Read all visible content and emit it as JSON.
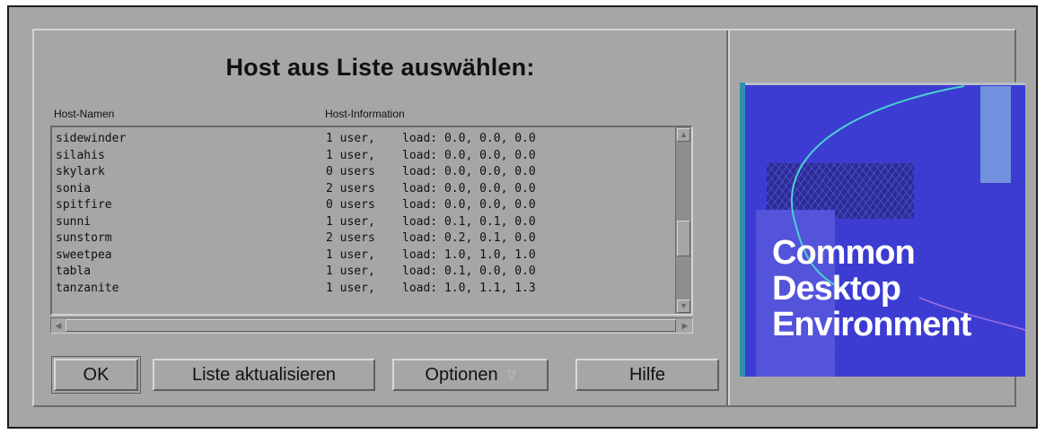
{
  "dialog": {
    "title": "Host aus Liste auswählen:",
    "columns": {
      "host_names": "Host-Namen",
      "host_info": "Host-Information"
    },
    "hosts": [
      {
        "name": "sidewinder",
        "users": "1 user,",
        "load": "load: 0.0, 0.0, 0.0"
      },
      {
        "name": "silahis",
        "users": "1 user,",
        "load": "load: 0.0, 0.0, 0.0"
      },
      {
        "name": "skylark",
        "users": "0 users",
        "load": "load: 0.0, 0.0, 0.0"
      },
      {
        "name": "sonia",
        "users": "2 users",
        "load": "load: 0.0, 0.0, 0.0"
      },
      {
        "name": "spitfire",
        "users": "0 users",
        "load": "load: 0.0, 0.0, 0.0"
      },
      {
        "name": "sunni",
        "users": "1 user,",
        "load": "load: 0.1, 0.1, 0.0"
      },
      {
        "name": "sunstorm",
        "users": "2 users",
        "load": "load: 0.2, 0.1, 0.0"
      },
      {
        "name": "sweetpea",
        "users": "1 user,",
        "load": "load: 1.0, 1.0, 1.0"
      },
      {
        "name": "tabla",
        "users": "1 user,",
        "load": "load: 0.1, 0.0, 0.0"
      },
      {
        "name": "tanzanite",
        "users": "1 user,",
        "load": "load: 1.0, 1.1, 1.3"
      }
    ],
    "buttons": {
      "ok": "OK",
      "refresh": "Liste aktualisieren",
      "options": "Optionen",
      "help": "Hilfe"
    }
  },
  "logo": {
    "lines": [
      "Common",
      "Desktop",
      "Environment"
    ]
  },
  "colors": {
    "window_bg": "#a6a6a6",
    "logo_bg": "#4141d6",
    "logo_accent": "#2e8fae"
  }
}
